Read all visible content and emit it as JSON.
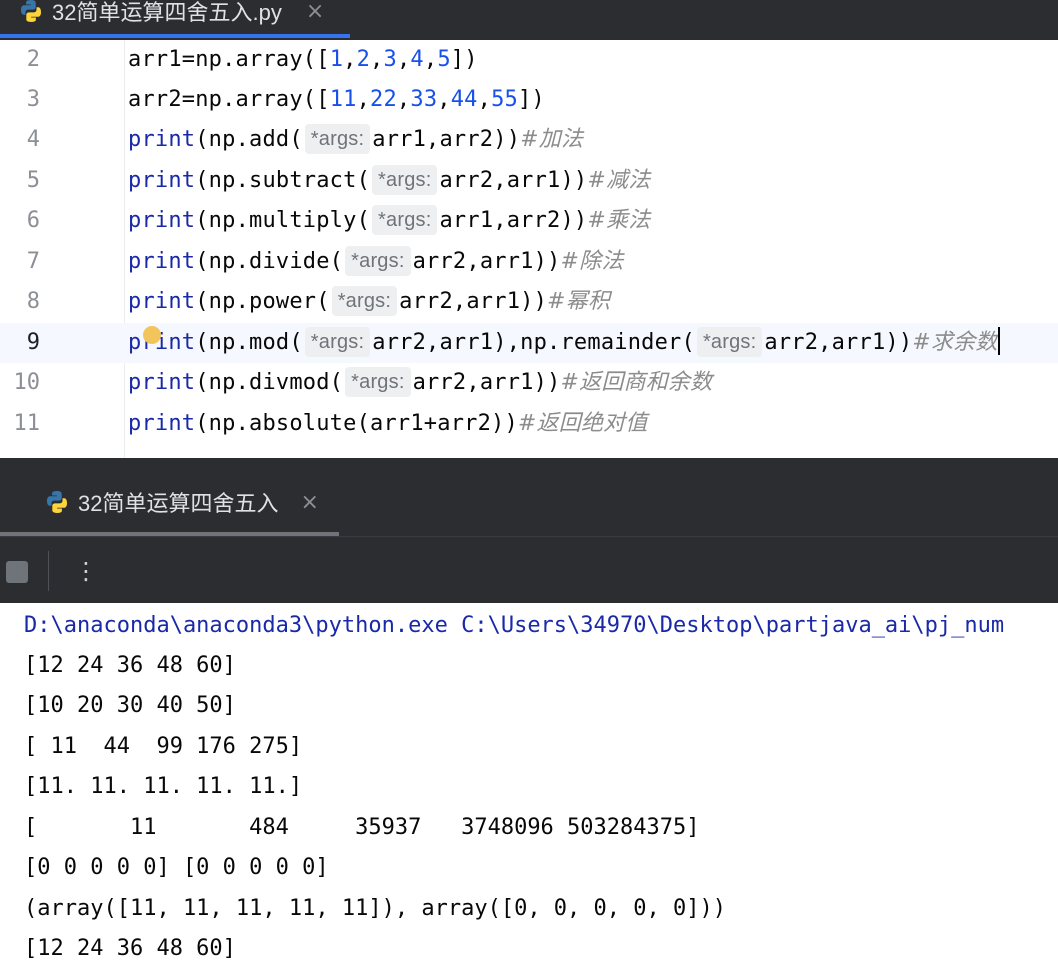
{
  "editor_tab": {
    "label": "32简单运算四舍五入.py",
    "close": "×"
  },
  "code_lines": [
    {
      "num": "2",
      "parts": [
        "arr1=np.array([",
        "1",
        ",",
        "2",
        ",",
        "3",
        ",",
        "4",
        ",",
        "5",
        "])"
      ]
    },
    {
      "num": "3",
      "parts": [
        "arr2=np.array([",
        "11",
        ",",
        "22",
        ",",
        "33",
        ",",
        "44",
        ",",
        "55",
        "])"
      ]
    },
    {
      "num": "4",
      "kw": "print",
      "a": "(np.add(",
      "hint": "*args:",
      "b": "arr1,arr2))",
      "comment": "#加法"
    },
    {
      "num": "5",
      "kw": "print",
      "a": "(np.subtract(",
      "hint": "*args:",
      "b": "arr2,arr1))",
      "comment": "#减法"
    },
    {
      "num": "6",
      "kw": "print",
      "a": "(np.multiply(",
      "hint": "*args:",
      "b": "arr1,arr2))",
      "comment": "#乘法"
    },
    {
      "num": "7",
      "kw": "print",
      "a": "(np.divide(",
      "hint": "*args:",
      "b": "arr2,arr1))",
      "comment": "#除法"
    },
    {
      "num": "8",
      "kw": "print",
      "a": "(np.power(",
      "hint": "*args:",
      "b": "arr2,arr1))",
      "comment": "#幂积"
    },
    {
      "num": "9",
      "kw": "print",
      "a": "(np.mod(",
      "hint": "*args:",
      "b": "arr2,arr1),np.remainder(",
      "hint2": "*args:",
      "c": "arr2,arr1))",
      "comment": "#求余数"
    },
    {
      "num": "10",
      "kw": "print",
      "a": "(np.divmod(",
      "hint": "*args:",
      "b": "arr2,arr1))",
      "comment": "#返回商和余数"
    },
    {
      "num": "11",
      "kw": "print",
      "a": "(np.absolute(arr1+arr2))",
      "comment": "#返回绝对值"
    }
  ],
  "run_tab": {
    "label": "32简单运算四舍五入",
    "close": "×"
  },
  "toolbar": {
    "more": "⋮"
  },
  "console": {
    "command": "D:\\anaconda\\anaconda3\\python.exe C:\\Users\\34970\\Desktop\\partjava_ai\\pj_num",
    "lines": [
      "[12 24 36 48 60]",
      "[10 20 30 40 50]",
      "[ 11  44  99 176 275]",
      "[11. 11. 11. 11. 11.]",
      "[       11       484     35937   3748096 503284375]",
      "[0 0 0 0 0] [0 0 0 0 0]",
      "(array([11, 11, 11, 11, 11]), array([0, 0, 0, 0, 0]))",
      "[12 24 36 48 60]"
    ]
  },
  "colors": {
    "keyword": "#1a29a8",
    "number": "#1750eb",
    "comment": "#8c8c8c",
    "panel_bg": "#2b2d30",
    "tab_accent": "#3574f0"
  }
}
